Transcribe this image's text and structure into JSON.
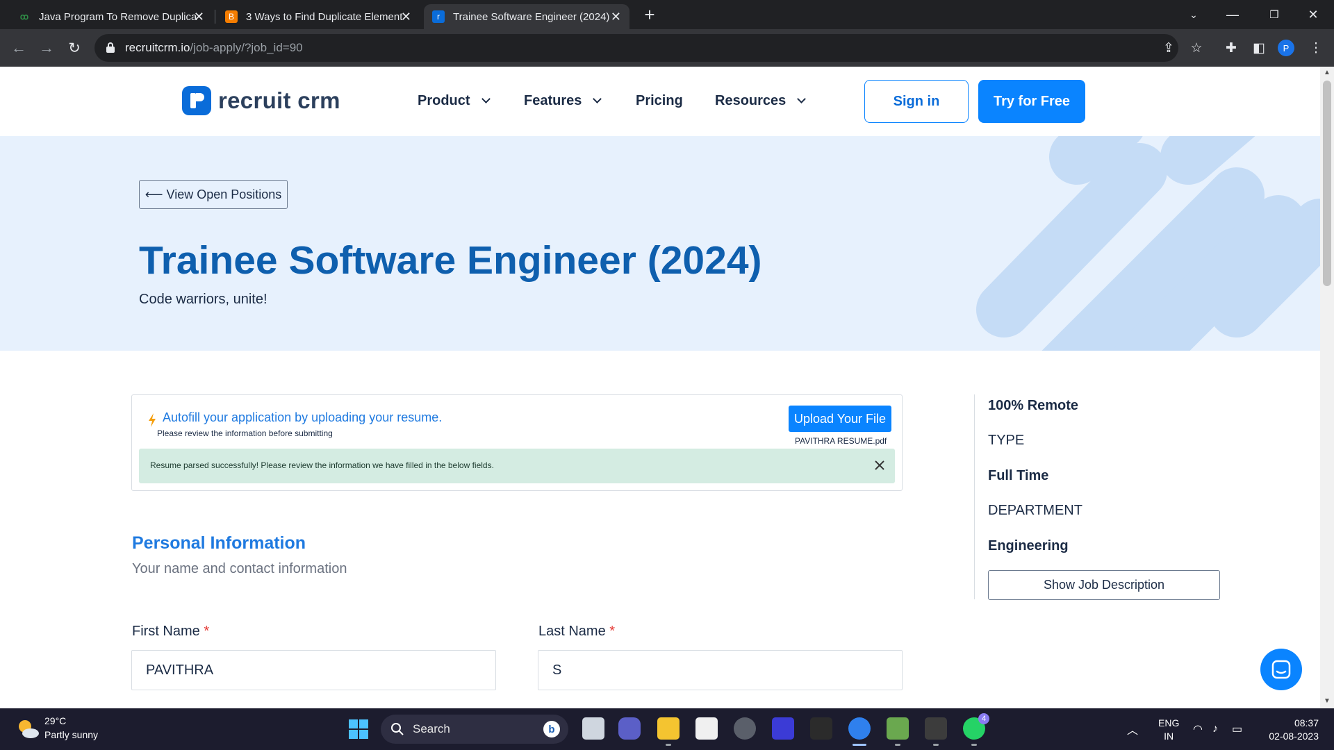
{
  "browser": {
    "tabs": [
      {
        "title": "Java Program To Remove Duplica",
        "icon": "geeksforgeeks-icon",
        "active": false
      },
      {
        "title": "3 Ways to Find Duplicate Element",
        "icon": "blogger-icon",
        "active": false
      },
      {
        "title": "Trainee Software Engineer (2024)",
        "icon": "recruitcrm-icon",
        "active": true
      }
    ],
    "url_host": "recruitcrm.io",
    "url_path": "/job-apply/?job_id=90",
    "profile_initial": "P"
  },
  "site": {
    "logo_text": "recruit crm",
    "nav": [
      {
        "label": "Product",
        "has_menu": true
      },
      {
        "label": "Features",
        "has_menu": true
      },
      {
        "label": "Pricing",
        "has_menu": false
      },
      {
        "label": "Resources",
        "has_menu": true
      }
    ],
    "signin_label": "Sign in",
    "try_label": "Try for Free"
  },
  "hero": {
    "back_label": "⟵ View Open Positions",
    "title": "Trainee Software Engineer (2024)",
    "tagline": "Code warriors, unite!"
  },
  "autofill": {
    "title": "Autofill your application by uploading your resume.",
    "subtitle": "Please review the information before submitting",
    "upload_label": "Upload Your File",
    "file_name": "PAVITHRA RESUME.pdf",
    "parsed_message": "Resume parsed successfully! Please review the information we have filled in the below fields."
  },
  "personal": {
    "title": "Personal Information",
    "subtitle": "Your name and contact information",
    "first_name_label": "First Name",
    "first_name_value": "PAVITHRA",
    "last_name_label": "Last Name",
    "last_name_value": "S",
    "required_mark": "*"
  },
  "sidebar": {
    "location": "100% Remote",
    "type_caption": "TYPE",
    "type_value": "Full Time",
    "department_caption": "DEPARTMENT",
    "department_value": "Engineering",
    "show_jd_label": "Show Job Description"
  },
  "taskbar": {
    "temperature": "29°C",
    "weather": "Partly sunny",
    "search_label": "Search",
    "whatsapp_badge": "4",
    "language": "ENG",
    "region": "IN",
    "time": "08:37",
    "date": "02-08-2023"
  },
  "colors": {
    "brand_blue": "#0a84ff",
    "title_blue": "#0e5fae",
    "hero_bg": "#e7f1fd",
    "success_bg": "#d4ece2"
  }
}
